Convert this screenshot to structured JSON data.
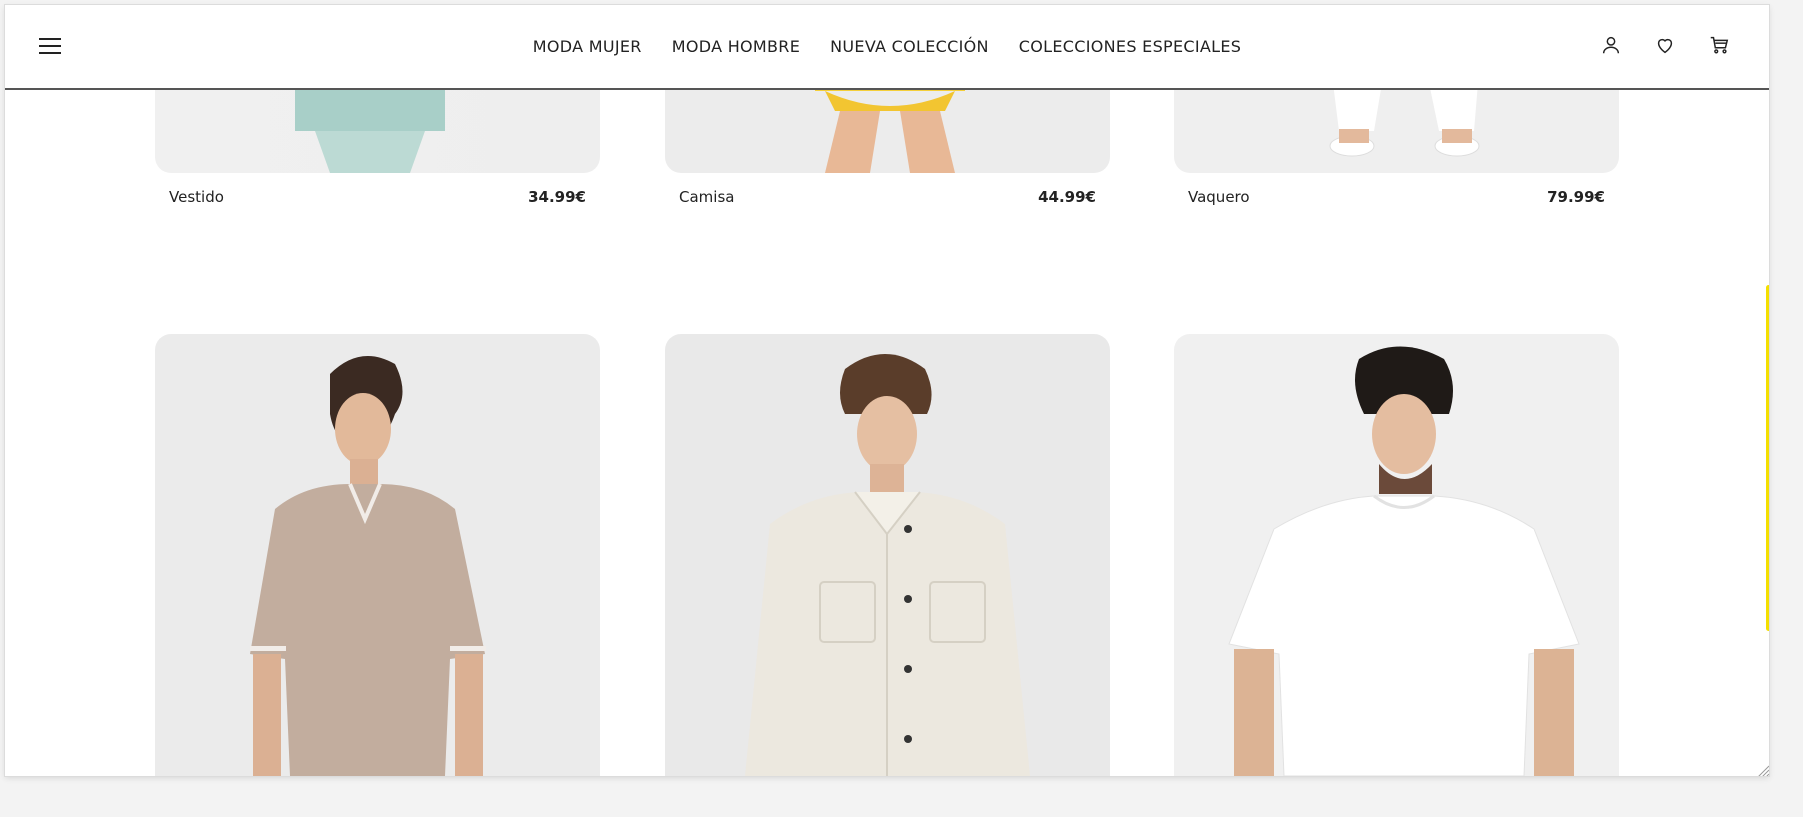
{
  "nav": {
    "items": [
      "MODA MUJER",
      "MODA HOMBRE",
      "NUEVA COLECCIÓN",
      "COLECCIONES ESPECIALES"
    ]
  },
  "icons": {
    "menu": "hamburger-menu-icon",
    "account": "user-icon",
    "wishlist": "heart-icon",
    "cart": "cart-icon"
  },
  "products_row1": [
    {
      "name": "Vestido",
      "price": "34.99€"
    },
    {
      "name": "Camisa",
      "price": "44.99€"
    },
    {
      "name": "Vaquero",
      "price": "79.99€"
    }
  ],
  "colors": {
    "accent": "#f4df00",
    "text": "#222222",
    "card_bg": "#ececec"
  }
}
